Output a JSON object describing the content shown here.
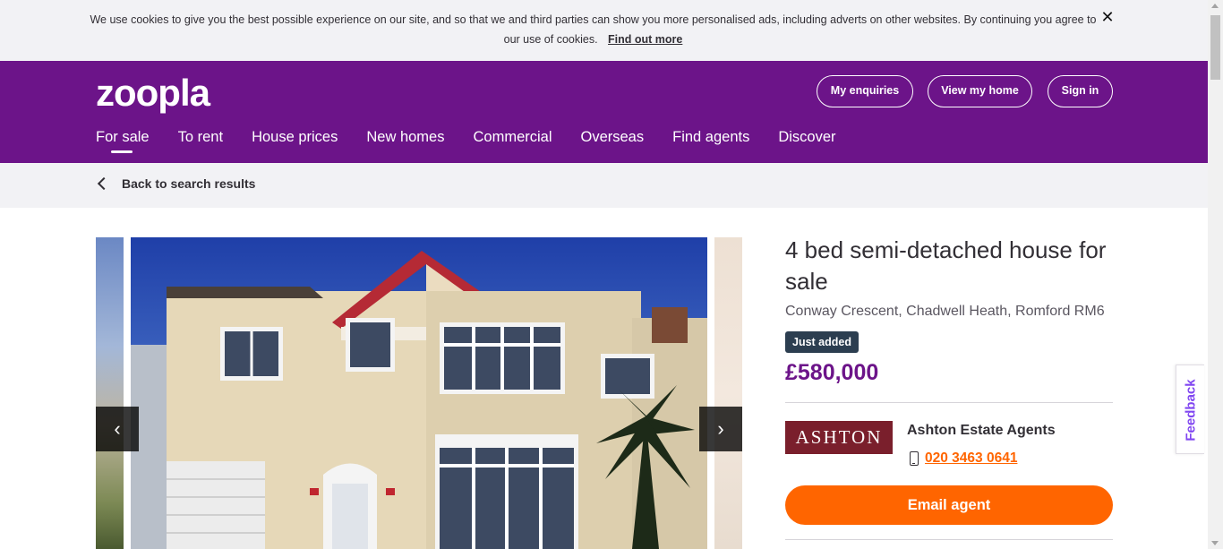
{
  "cookie": {
    "text": "We use cookies to give you the best possible experience on our site, and so that we and third parties can show you more personalised ads, including adverts on other websites. By continuing you agree to our use of cookies.",
    "link": "Find out more",
    "close_icon": "close-icon",
    "close_glyph": "✕"
  },
  "header": {
    "logo": "zoopla",
    "buttons": {
      "enquiries": "My enquiries",
      "view_home": "View my home",
      "sign_in": "Sign in"
    },
    "nav": [
      "For sale",
      "To rent",
      "House prices",
      "New homes",
      "Commercial",
      "Overseas",
      "Find agents",
      "Discover"
    ],
    "active_nav": "For sale",
    "bg_color": "#6c1489"
  },
  "breadcrumb": {
    "label": "Back to search results",
    "icon": "chevron-left-icon"
  },
  "gallery": {
    "prev_glyph": "‹",
    "next_glyph": "›",
    "prev_icon": "chevron-left-icon",
    "next_icon": "chevron-right-icon"
  },
  "listing": {
    "title": "4 bed semi-detached house for sale",
    "address": "Conway Crescent, Chadwell Heath, Romford RM6",
    "badge": "Just added",
    "price": "£580,000",
    "price_color": "#6c1489"
  },
  "agent": {
    "logo_text": "ASHTON",
    "name": "Ashton Estate Agents",
    "phone": "020 3463 0641",
    "phone_color": "#ff6500",
    "email_button": "Email agent",
    "email_color": "#ff6500"
  },
  "feedback": {
    "label": "Feedback"
  }
}
